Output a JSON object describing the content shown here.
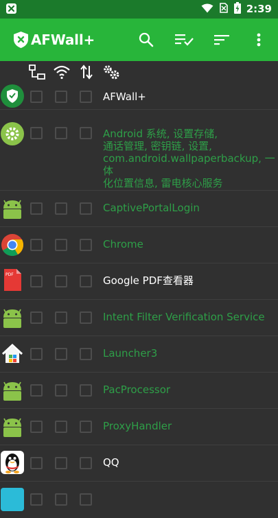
{
  "status_bar": {
    "time": "2:39",
    "left_icon": "afwall-notification-icon",
    "right_icons": [
      "wifi-icon",
      "no-sim-icon",
      "battery-charging-icon"
    ]
  },
  "app_bar": {
    "title": "AFWall+",
    "logo": "afwall-shield-logo",
    "actions": [
      "search-icon",
      "select-all-icon",
      "sort-icon",
      "more-vert-icon"
    ],
    "background": "#28b53a"
  },
  "column_headers": [
    "lan-icon",
    "wifi-icon",
    "mobile-data-icon",
    "settings-icon"
  ],
  "apps": [
    {
      "name": "AFWall+",
      "icon": "afwall-app-icon",
      "color": "#ffffff"
    },
    {
      "name": "Android 系统, 设置存储, 通话管理, 密钥链, 设置, com.android.wallpaperbackup, 一体化位置信息, 雷电核心服务",
      "lines": [
        "Android 系统, 设置存储,",
        "通话管理, 密钥链, 设置,",
        "com.android.wallpaperbackup, 一体",
        "化位置信息, 雷电核心服务"
      ],
      "icon": "android-settings-icon",
      "color": "#2e9f48"
    },
    {
      "name": "CaptivePortalLogin",
      "icon": "android-robot-icon",
      "color": "#2e9f48"
    },
    {
      "name": "Chrome",
      "icon": "chrome-icon",
      "color": "#2e9f48"
    },
    {
      "name": "Google PDF查看器",
      "icon": "pdf-viewer-icon",
      "color": "#ffffff"
    },
    {
      "name": "Intent Filter Verification Service",
      "icon": "android-robot-icon",
      "color": "#2e9f48"
    },
    {
      "name": "Launcher3",
      "icon": "launcher-home-icon",
      "color": "#2e9f48"
    },
    {
      "name": "PacProcessor",
      "icon": "android-robot-icon",
      "color": "#2e9f48"
    },
    {
      "name": "ProxyHandler",
      "icon": "android-robot-icon",
      "color": "#2e9f48"
    },
    {
      "name": "QQ",
      "icon": "qq-penguin-icon",
      "color": "#ffffff"
    },
    {
      "name": "",
      "icon": "partial-app-icon",
      "color": "#2e9f48"
    }
  ]
}
